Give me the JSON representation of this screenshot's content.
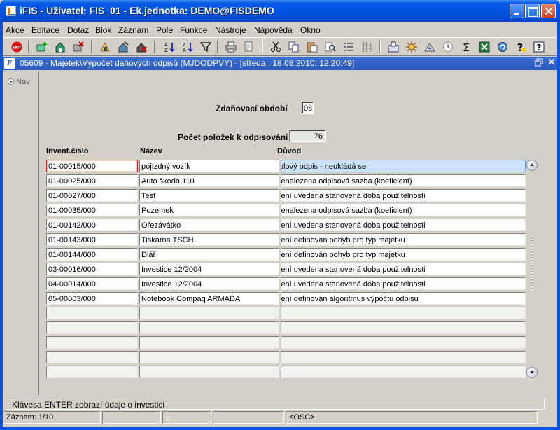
{
  "app": {
    "title": "iFIS - Uživatel: FIS_01 - Ek.jednotka: DEMO@FISDEMO"
  },
  "menu": {
    "items": [
      "Akce",
      "Editace",
      "Dotaz",
      "Blok",
      "Záznam",
      "Pole",
      "Funkce",
      "Nástroje",
      "Nápověda",
      "Okno"
    ]
  },
  "toolbar": {
    "icons": [
      "exit-icon",
      "add-record-icon",
      "save-icon",
      "delete-icon",
      "edit-record-icon",
      "copy-record-icon",
      "remove-record-icon",
      "sort-ascending-icon",
      "sort-descending-icon",
      "filter-icon",
      "print-icon",
      "print-preview-icon",
      "cut-icon",
      "copy-icon",
      "paste-icon",
      "find-icon",
      "list-icon",
      "columns-icon",
      "export-icon",
      "settings-icon",
      "alert-icon",
      "clock-icon",
      "sum-icon",
      "excel-icon",
      "refresh-icon",
      "help-icon",
      "context-help-icon"
    ]
  },
  "window": {
    "title": "05609 - Majetek\\Výpočet daňových odpisů (MJDODPVY) - [středa , 18.08.2010; 12:20:49]"
  },
  "nav": {
    "label": "Nav"
  },
  "form": {
    "period_label": "Zdaňovací období",
    "period_value": "08",
    "count_label": "Počet položek k odpisování",
    "count_value": "76"
  },
  "table": {
    "headers": [
      "Invent.číslo",
      "Název",
      "Důvod"
    ],
    "rows": [
      [
        "01-00015/000",
        "pojízdný vozík",
        "ulový odpis - neukládá se"
      ],
      [
        "01-00025/000",
        "Auto škoda 110",
        "lenalezena odpisová sazba (koeficient)"
      ],
      [
        "01-00027/000",
        "Test",
        "lení uvedena stanovená doba použitelnosti"
      ],
      [
        "01-00035/000",
        "Pozemek",
        "lenalezena odpisová sazba (koeficient)"
      ],
      [
        "01-00142/000",
        "Ořezávátko",
        "lení uvedena stanovená doba použitelnosti"
      ],
      [
        "01-00143/000",
        "Tiskárna TSCH",
        "lení definován pohyb pro typ majetku"
      ],
      [
        "01-00144/000",
        "Diář",
        "lení definován pohyb pro typ majetku"
      ],
      [
        "03-00016/000",
        "Investice 12/2004",
        "lení uvedena stanovená doba použitelnosti"
      ],
      [
        "04-00014/000",
        "Investice 12/2004",
        "lení uvedena stanovená doba použitelnosti"
      ],
      [
        "05-00003/000",
        "Notebook Compaq ARMADA",
        "lení definován algoritmus výpočtu odpisu"
      ],
      [
        "",
        "",
        ""
      ],
      [
        "",
        "",
        ""
      ],
      [
        "",
        "",
        ""
      ],
      [
        "",
        "",
        ""
      ],
      [
        "",
        "",
        ""
      ]
    ]
  },
  "status": {
    "hint": "Klávesa ENTER zobrazí údaje o investici",
    "record": "Záznam: 1/10",
    "seg2": "",
    "seg3": "...",
    "seg4": "",
    "mode": "<OSC>"
  }
}
